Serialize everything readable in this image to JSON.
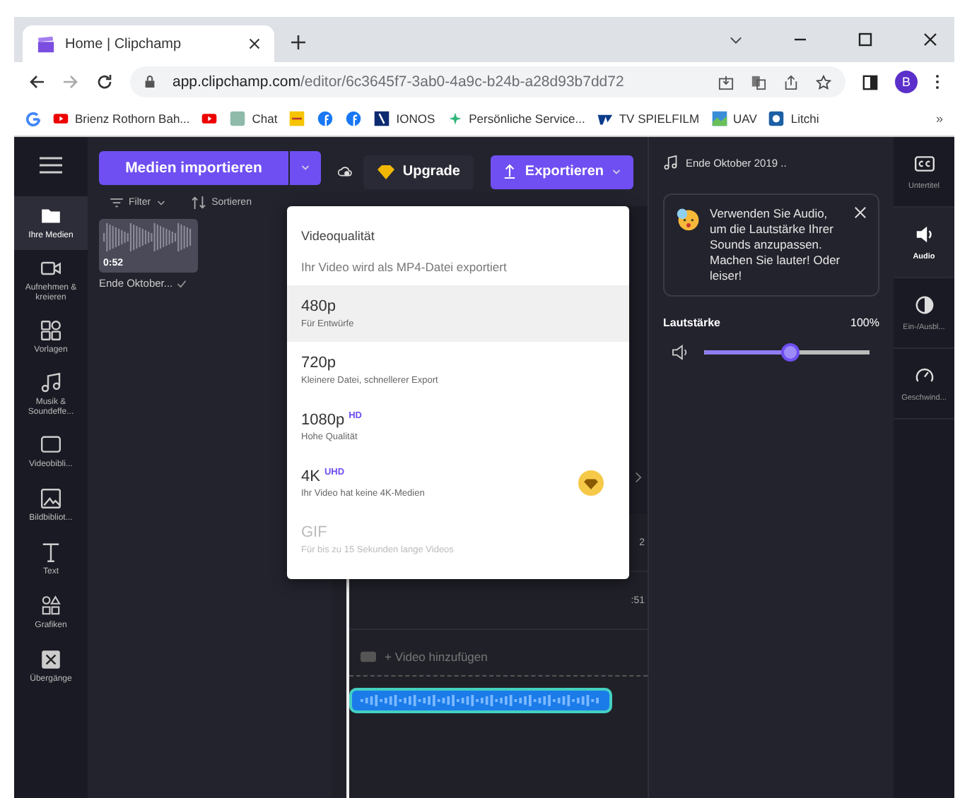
{
  "browser": {
    "tab_title": "Home | Clipchamp",
    "url_host": "app.clipchamp.com",
    "url_path": "/editor/6c3645f7-3ab0-4a9c-b24b-a28d93b7dd72",
    "avatar": "B",
    "bookmarks": [
      {
        "kind": "link",
        "label": "Brienz Rothorn Bah..."
      },
      {
        "kind": "icon"
      },
      {
        "kind": "link",
        "label": "Chat"
      },
      {
        "kind": "icon"
      },
      {
        "kind": "icon"
      },
      {
        "kind": "icon"
      },
      {
        "kind": "link",
        "label": "IONOS"
      },
      {
        "kind": "link",
        "label": "Persönliche Service..."
      },
      {
        "kind": "link",
        "label": "TV SPIELFILM"
      },
      {
        "kind": "link",
        "label": "UAV"
      },
      {
        "kind": "link",
        "label": "Litchi"
      }
    ],
    "more": "»"
  },
  "nav": [
    {
      "label": "Ihre Medien",
      "selected": true
    },
    {
      "label": "Aufnehmen & kreieren",
      "selected": false
    },
    {
      "label": "Vorlagen",
      "selected": false
    },
    {
      "label": "Musik & Soundeffe...",
      "selected": false
    },
    {
      "label": "Videobibli...",
      "selected": false
    },
    {
      "label": "Bildbibliot...",
      "selected": false
    },
    {
      "label": "Text",
      "selected": false
    },
    {
      "label": "Grafiken",
      "selected": false
    },
    {
      "label": "Übergänge",
      "selected": false
    }
  ],
  "media": {
    "import_button": "Medien importieren",
    "filter": "Filter",
    "sort": "Sortieren",
    "items": [
      {
        "duration": "0:52",
        "name": "Ende Oktober..."
      }
    ]
  },
  "toolbar": {
    "upgrade": "Upgrade",
    "export": "Exportieren"
  },
  "export_menu": {
    "title": "Videoqualität",
    "subtitle": "Ihr Video wird als MP4-Datei exportiert",
    "options": [
      {
        "label": "480p",
        "description": "Für Entwürfe",
        "selected": true,
        "disabled": false,
        "premium": false
      },
      {
        "label": "720p",
        "description": "Kleinere Datei, schnellerer Export",
        "selected": false,
        "disabled": false,
        "premium": false
      },
      {
        "label": "1080p",
        "badge": "HD",
        "description": "Hohe Qualität",
        "selected": false,
        "disabled": false,
        "premium": false
      },
      {
        "label": "4K",
        "badge": "UHD",
        "description": "Ihr Video hat keine 4K-Medien",
        "selected": false,
        "disabled": false,
        "premium": true
      },
      {
        "label": "GIF",
        "description": "Für bis zu 15 Sekunden lange Videos",
        "selected": false,
        "disabled": true,
        "premium": false
      }
    ]
  },
  "timeline": {
    "times": [
      "2",
      ":51"
    ],
    "add_video": "+ Video hinzufügen"
  },
  "audio_panel": {
    "title": "Ende Oktober 2019 ..",
    "tip": "Verwenden Sie Audio, um die Lautstärke Ihrer Sounds anzupassen. Machen Sie lauter! Oder leiser!",
    "volume_label": "Lautstärke",
    "volume_reading": "100%",
    "volume": {
      "level": 0.52
    }
  },
  "rail": [
    {
      "label": "Untertitel",
      "selected": false
    },
    {
      "label": "Audio",
      "selected": true
    },
    {
      "label": "Ein-/Ausbl...",
      "selected": false
    },
    {
      "label": "Geschwind...",
      "selected": false
    }
  ]
}
